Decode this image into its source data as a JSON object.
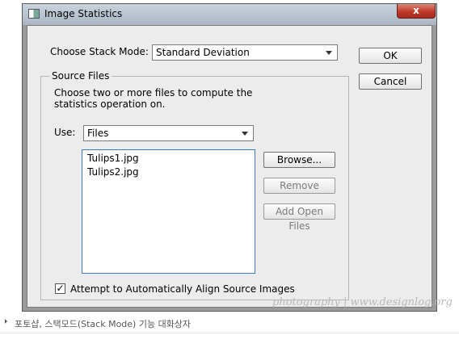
{
  "window": {
    "title": "Image Statistics",
    "close_glyph": "x"
  },
  "stack_mode": {
    "label": "Choose Stack Mode:",
    "selected": "Standard Deviation"
  },
  "buttons": {
    "ok": "OK",
    "cancel": "Cancel"
  },
  "source_files": {
    "group_title": "Source Files",
    "description": "Choose two or more files to compute the statistics operation on.",
    "use_label": "Use:",
    "use_selected": "Files",
    "files": [
      "Tulips1.jpg",
      "Tulips2.jpg"
    ],
    "browse_label": "Browse...",
    "remove_label": "Remove",
    "add_open_label": "Add Open Files"
  },
  "align": {
    "label": "Attempt to Automatically Align Source Images",
    "checked": true,
    "check_glyph": "✓"
  },
  "watermark": "photography | www.designlog.org",
  "caption": "포토샵, 스택모드(Stack Mode) 기능 대화상자"
}
